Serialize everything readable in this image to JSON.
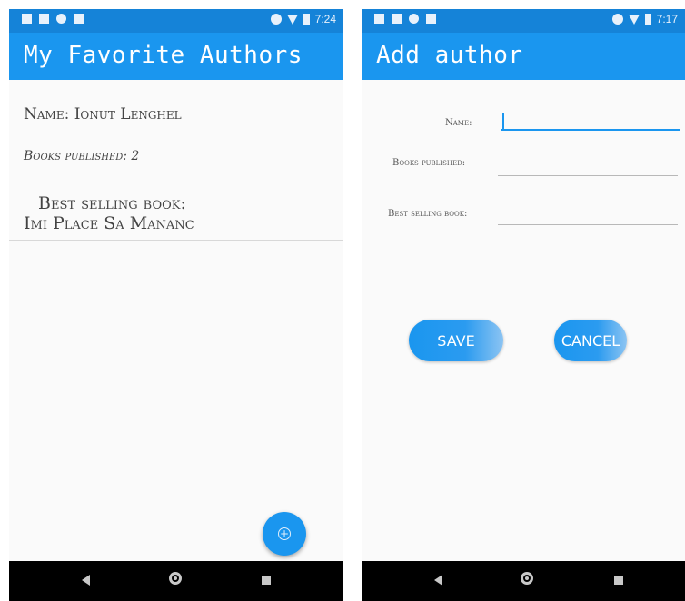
{
  "left_screen": {
    "status_time": "7:24",
    "app_title": "My Favorite Authors",
    "author": {
      "name_line": "Name: Ionut Lenghel",
      "books_line": "Books published: 2",
      "best_label": "Best selling book:",
      "best_value": "Imi Place Sa Mananc"
    },
    "fab_icon": "plus-circle-icon"
  },
  "right_screen": {
    "status_time": "7:17",
    "app_title": "Add author",
    "form": {
      "name_label": "Name:",
      "books_label": "Books published:",
      "best_label": "Best selling book:",
      "name_value": "",
      "books_value": "",
      "best_value": ""
    },
    "save_label": "SAVE",
    "cancel_label": "CANCEL"
  },
  "colors": {
    "statusbar": "#1583d8",
    "appbar": "#1a96ef",
    "accent": "#1a96ef",
    "navbar": "#000000"
  },
  "icons": {
    "status_left": [
      "settings-icon",
      "notification-icon",
      "circle-icon",
      "sd-card-icon"
    ],
    "status_right": [
      "dnd-icon",
      "wifi-icon",
      "signal-icon",
      "battery-icon"
    ],
    "nav": [
      "back-icon",
      "home-icon",
      "recents-icon"
    ]
  }
}
